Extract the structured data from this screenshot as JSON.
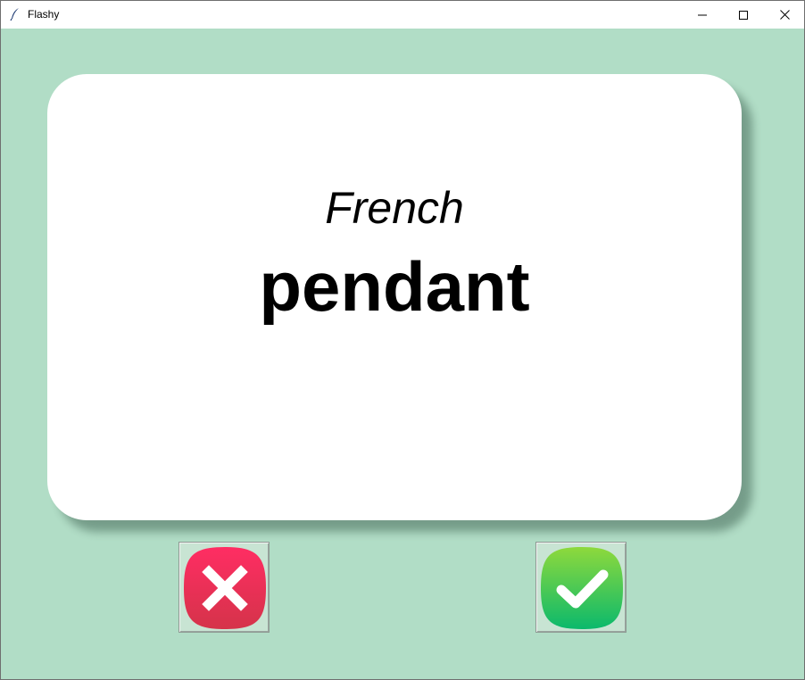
{
  "window": {
    "title": "Flashy",
    "icon": "feather-icon",
    "controls": [
      "minimize-icon",
      "maximize-icon",
      "close-icon"
    ]
  },
  "card": {
    "title": "French",
    "word": "pendant"
  },
  "buttons": {
    "wrong": {
      "icon": "cross-icon",
      "color": "#e9345a"
    },
    "right": {
      "icon": "checkmark-icon",
      "color": "#2fc35d"
    }
  },
  "colors": {
    "background": "#b1ddc6",
    "card": "#ffffff"
  }
}
